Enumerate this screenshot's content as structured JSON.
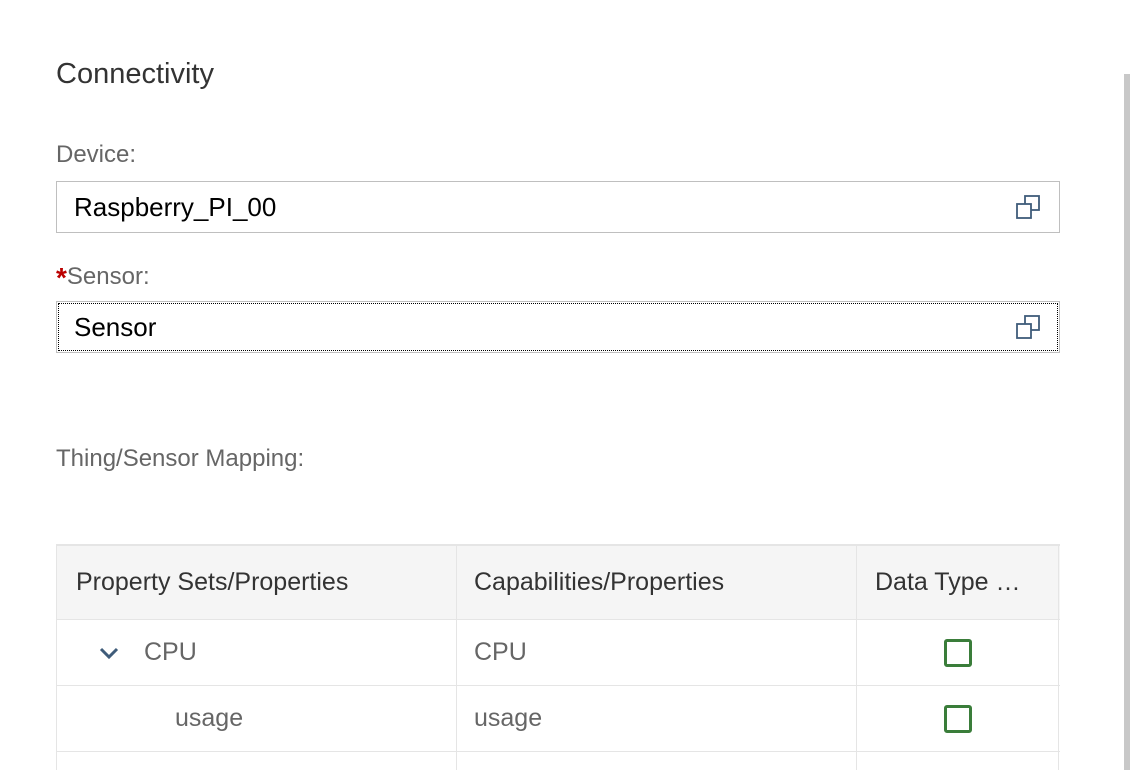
{
  "section": {
    "title": "Connectivity"
  },
  "device": {
    "label": "Device:",
    "value": "Raspberry_PI_00",
    "icon": "value-help-icon"
  },
  "sensor": {
    "required_marker": "*",
    "label": "Sensor:",
    "value": "Sensor",
    "icon": "value-help-icon"
  },
  "mapping": {
    "label": "Thing/Sensor Mapping:",
    "columns": [
      "Property Sets/Properties",
      "Capabilities/Properties",
      "Data Type …"
    ],
    "rows": [
      {
        "property": "CPU",
        "capability": "CPU",
        "expanded": true,
        "checked": false
      },
      {
        "property": "usage",
        "capability": "usage",
        "checked": false
      }
    ]
  },
  "colors": {
    "required": "#bb0000",
    "checkbox_border": "#3a7d3a",
    "icon": "#3f5c7a"
  }
}
